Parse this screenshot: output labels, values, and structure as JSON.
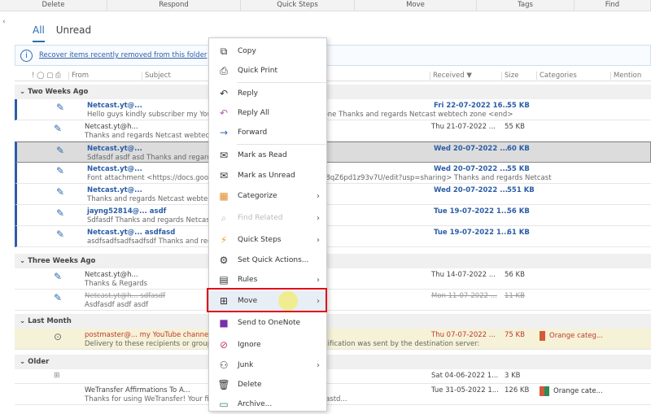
{
  "ribbon": [
    "Delete",
    "Respond",
    "Quick Steps",
    "Move",
    "Tags",
    "Find"
  ],
  "tabs": {
    "all": "All",
    "unread": "Unread"
  },
  "info": {
    "text": "Recover items recently removed from this folder"
  },
  "columns": {
    "from": "From",
    "subject": "Subject",
    "received": "Received ▼",
    "size": "Size",
    "categories": "Categories",
    "mention": "Mention"
  },
  "groups": {
    "g1": "Two Weeks Ago",
    "g2": "Three Weeks Ago",
    "g3": "Last Month",
    "g4": "Older"
  },
  "rows": [
    {
      "from": "Netcast.yt@...",
      "preview": "Hello guys kindly subscriber my YouTube channel Netcast webtech zone  Thanks and regards  Netcast webtech zone <end>",
      "received": "Fri 22-07-2022 16...",
      "size": "55 KB"
    },
    {
      "from": "Netcast.yt@h...",
      "preview": "Thanks and regards  Netcast webtech zone",
      "received": "Thu 21-07-2022 ...",
      "size": "55 KB"
    },
    {
      "from": "Netcast.yt@...",
      "preview": "Sdfasdf asdf asd  Thanks and regards  Netcast webtech zone <end>",
      "received": "Wed 20-07-2022 ...",
      "size": "60 KB"
    },
    {
      "from": "Netcast.yt@...",
      "preview": "Font attachment <https://docs.google.com/...wwCWJI-VD7FPjesONub8qZ6pd1z93v7U/edit?usp=sharing>    Thanks and regards  Netcast",
      "received": "Wed 20-07-2022 ...",
      "size": "55 KB"
    },
    {
      "from": "Netcast.yt@...",
      "preview": "Thanks and regards  Netcast webtech zone",
      "received": "Wed 20-07-2022 ...",
      "size": "551 KB"
    },
    {
      "from": "jayng52814@...   asdf",
      "preview": "Sdfasdf  Thanks and regards  Netcast webtech zone",
      "received": "Tue 19-07-2022 1...",
      "size": "56 KB"
    },
    {
      "from": "Netcast.yt@...   asdfasd",
      "preview": "asdfsadfsadfsadfsdf  Thanks and regards <end>",
      "received": "Tue 19-07-2022 1...",
      "size": "61 KB"
    },
    {
      "from": "Netcast.yt@h...",
      "preview": "Thanks & Regards",
      "received": "Thu 14-07-2022 ...",
      "size": "56 KB"
    },
    {
      "from": "Netcast.yt@h...   sdfasdf",
      "preview": "Asdfasdf asdf asdf",
      "received": "Mon 11-07-2022 ...",
      "size": "11 KB"
    },
    {
      "from": "postmaster@...   my YouTube channel",
      "preview": "Delivery to these recipients or groups is complete, but no delivery notification was sent by the destination server:",
      "received": "Thu 07-07-2022 ...",
      "size": "75 KB",
      "category": "Orange categ..."
    },
    {
      "from": "",
      "preview": "",
      "received": "Sat 04-06-2022 1...",
      "size": "3 KB"
    },
    {
      "from": "WeTransfer        Affirmations To A...",
      "preview": "Thanks for using WeTransfer! Your files were sent successfully to netcastd...",
      "received": "Tue 31-05-2022 1...",
      "size": "126 KB",
      "category": "Orange cate..."
    }
  ],
  "menu": [
    "Copy",
    "Quick Print",
    "Reply",
    "Reply All",
    "Forward",
    "Mark as Read",
    "Mark as Unread",
    "Categorize",
    "Find Related",
    "Quick Steps",
    "Set Quick Actions...",
    "Rules",
    "Move",
    "Send to OneNote",
    "Ignore",
    "Junk",
    "Delete",
    "Archive..."
  ],
  "colors": {
    "accent": "#2b5da8",
    "highlight": "#e0101a"
  }
}
